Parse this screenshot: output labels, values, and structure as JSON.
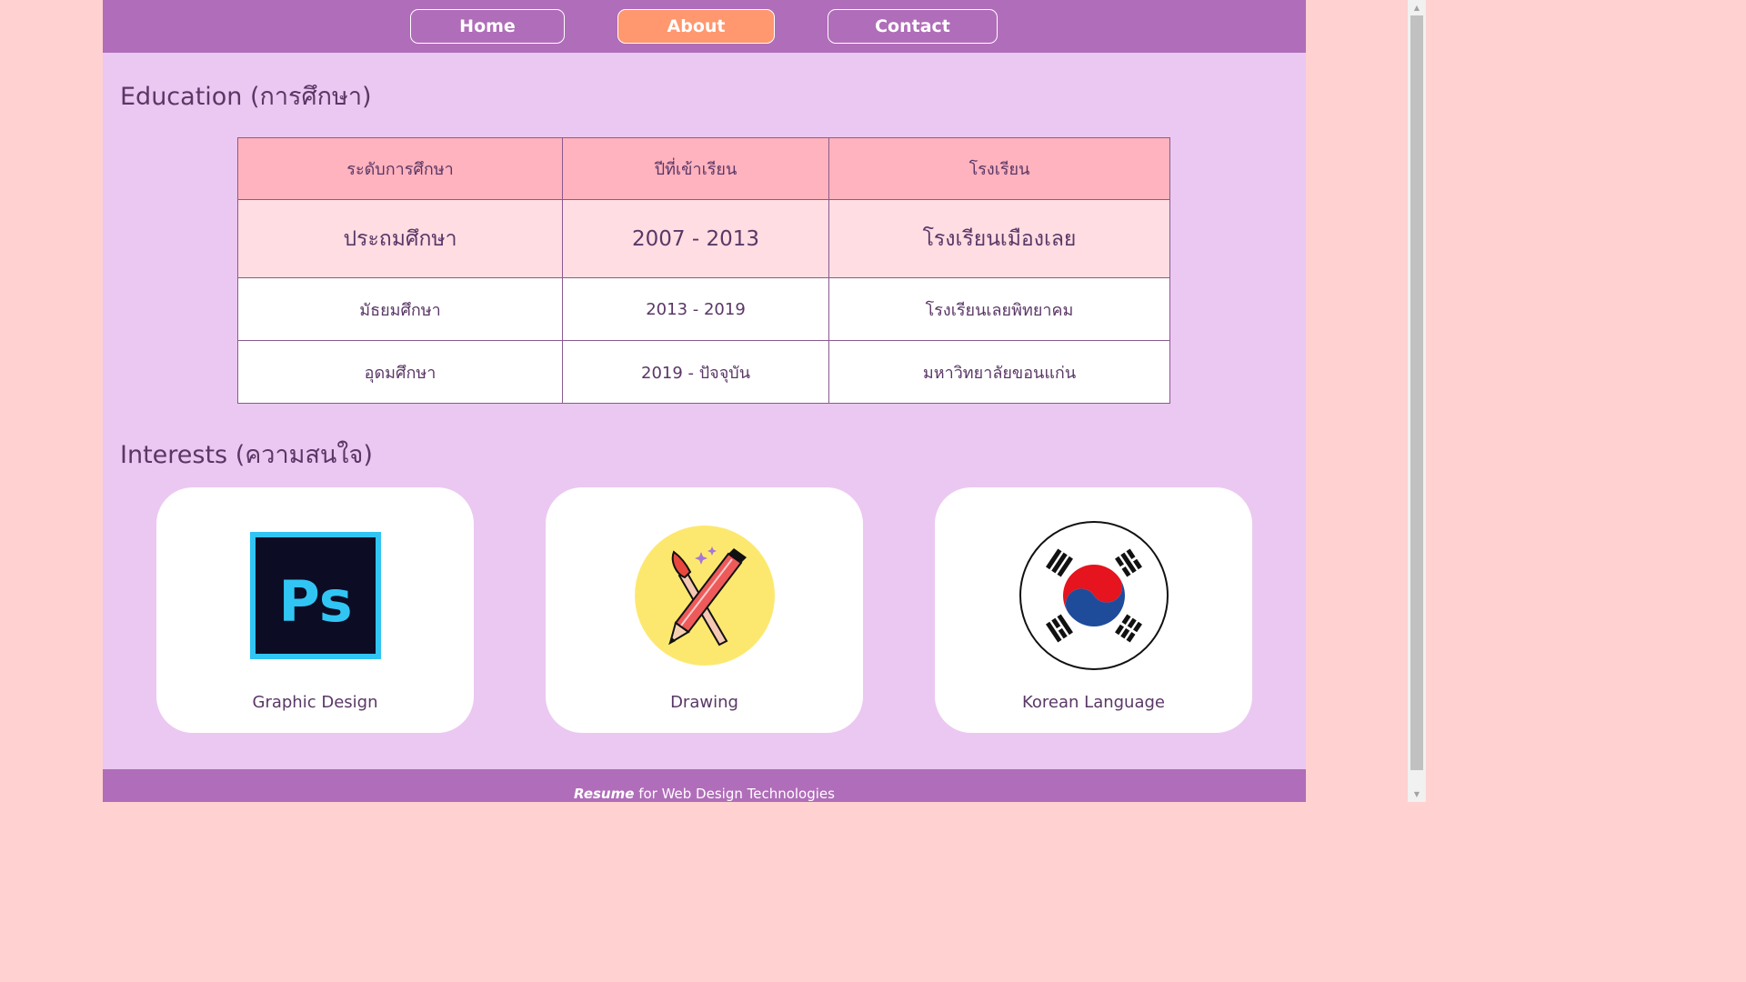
{
  "nav": {
    "home": "Home",
    "about": "About",
    "contact": "Contact",
    "active_color": "#ff976f",
    "bar_color": "#b06db9"
  },
  "education": {
    "title": "Education (การศึกษา)",
    "headers": [
      "ระดับการศึกษา",
      "ปีที่เข้าเรียน",
      "โรงเรียน"
    ],
    "rows": [
      [
        "ประถมศึกษา",
        "2007 - 2013",
        "โรงเรียนเมืองเลย"
      ],
      [
        "มัธยมศึกษา",
        "2013 - 2019",
        "โรงเรียนเลยพิทยาคม"
      ],
      [
        "อุดมศึกษา",
        "2019 - ปัจจุบัน",
        "มหาวิทยาลัยขอนแก่น"
      ]
    ]
  },
  "interests": {
    "title": "Interests (ความสนใจ)",
    "cards": [
      {
        "label": "Graphic Design",
        "icon": "photoshop-logo"
      },
      {
        "label": "Drawing",
        "icon": "pencil-brush-icon"
      },
      {
        "label": "Korean Language",
        "icon": "korean-flag"
      }
    ]
  },
  "footer": {
    "brand": "Resume",
    "text": " for Web Design Technologies"
  }
}
